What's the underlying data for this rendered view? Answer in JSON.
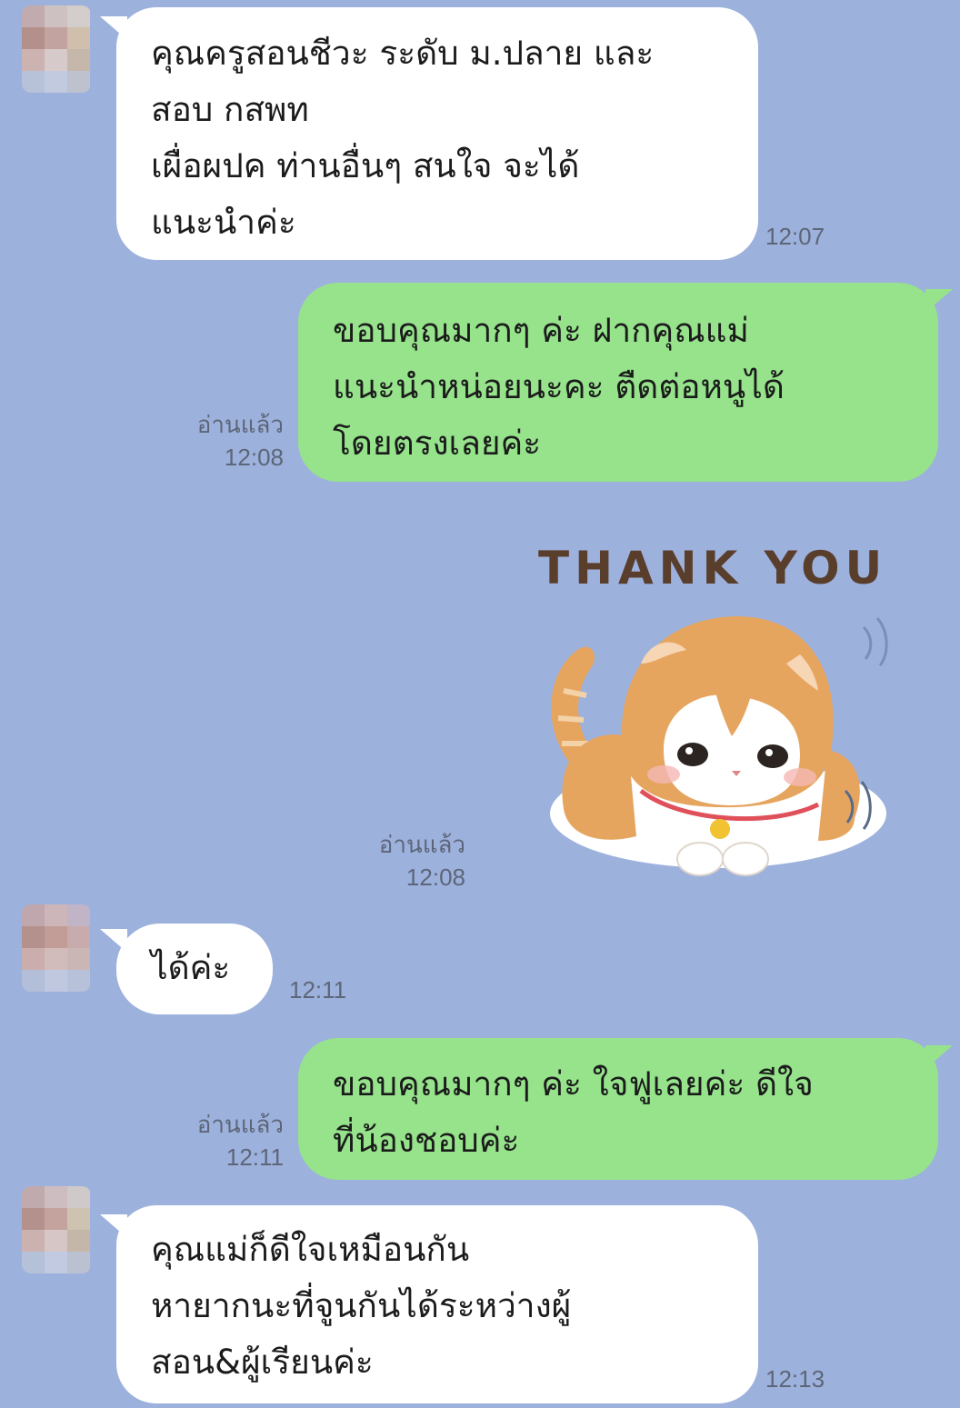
{
  "messages": [
    {
      "text": "คุณครูสอนชีวะ ระดับ ม.ปลาย และ\nสอบ กสพท\n เผื่อผปค ท่านอื่นๆ สนใจ จะได้\nแนะนำค่ะ",
      "time": "12:07"
    },
    {
      "text": "ขอบคุณมากๆ ค่ะ ฝากคุณแม่\nแนะนำหน่อยนะคะ ตืดต่อหนูได้\nโดยตรงเลยค่ะ",
      "read": "อ่านแล้ว",
      "time": "12:08"
    },
    {
      "sticker_text": "THANK YOU",
      "read": "อ่านแล้ว",
      "time": "12:08"
    },
    {
      "text": "ได้ค่ะ",
      "time": "12:11"
    },
    {
      "text": "ขอบคุณมากๆ ค่ะ ใจฟูเลยค่ะ ดีใจ\nที่น้องชอบค่ะ",
      "read": "อ่านแล้ว",
      "time": "12:11"
    },
    {
      "text": "คุณแม่ก็ดีใจเหมือนกัน\nหายากนะที่จูนกันได้ระหว่างผู้\nสอน&ผู้เรียนค่ะ",
      "time": "12:13"
    }
  ],
  "colors": {
    "background": "#9db1dd",
    "incoming_bubble": "#ffffff",
    "outgoing_bubble": "#96e38c"
  }
}
